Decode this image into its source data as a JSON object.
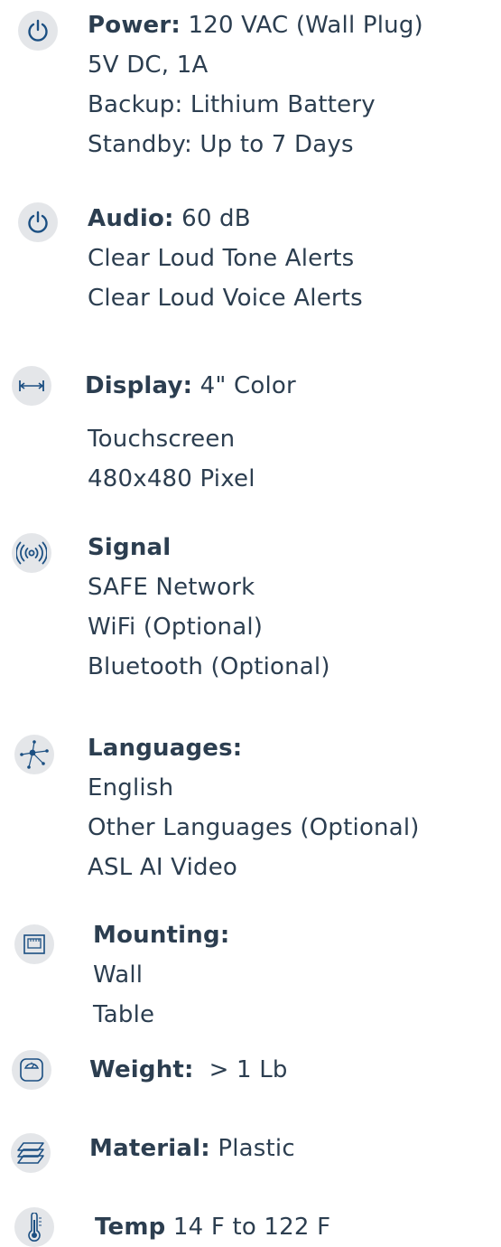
{
  "specs": {
    "power": {
      "icon": "power-icon",
      "label": "Power:",
      "value": " 120 VAC (Wall Plug)",
      "lines": [
        "5V DC, 1A",
        "Backup: Lithium Battery",
        "Standby: Up to 7 Days"
      ]
    },
    "audio": {
      "icon": "power-icon",
      "label": "Audio:",
      "value": " 60 dB",
      "lines": [
        "Clear Loud Tone Alerts",
        "Clear Loud Voice Alerts"
      ]
    },
    "display": {
      "icon": "display-width-icon",
      "label": "Display:",
      "value": " 4\" Color",
      "lines": [
        "Touchscreen",
        "480x480 Pixel"
      ]
    },
    "signal": {
      "icon": "signal-icon",
      "label": "Signal",
      "value": "",
      "lines": [
        "SAFE Network",
        "WiFi (Optional)",
        "Bluetooth (Optional)"
      ]
    },
    "languages": {
      "icon": "network-icon",
      "label": "Languages:",
      "value": "",
      "lines": [
        "English",
        "Other Languages (Optional)",
        "ASL AI Video"
      ]
    },
    "mounting": {
      "icon": "wall-mount-icon",
      "label": "Mounting:",
      "value": "",
      "lines": [
        "Wall",
        "Table"
      ]
    },
    "weight": {
      "icon": "scale-icon",
      "label": "Weight:",
      "value": "  > 1 Lb",
      "lines": []
    },
    "material": {
      "icon": "layers-icon",
      "label": "Material:",
      "value": " Plastic",
      "lines": []
    },
    "temp": {
      "icon": "thermometer-icon",
      "label": "Temp",
      "value": " 14 F to 122 F",
      "lines": []
    }
  },
  "colors": {
    "text": "#2c3e50",
    "icon_bg": "#e4e6e9",
    "icon_stroke": "#1b4f82"
  }
}
